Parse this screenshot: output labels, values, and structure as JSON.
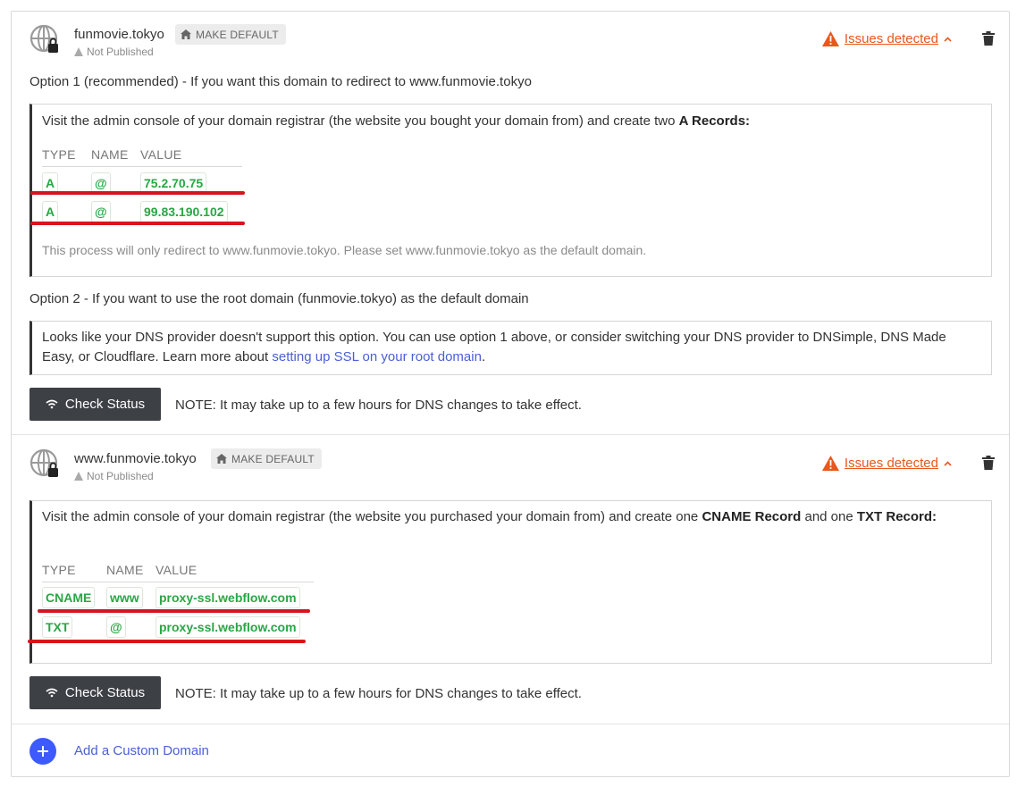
{
  "domains": [
    {
      "name": "funmovie.tokyo",
      "status": "Not Published",
      "make_default": "MAKE DEFAULT",
      "issues": "Issues detected",
      "option1_title": "Option 1 (recommended) - If you want this domain to redirect to www.funmovie.tokyo",
      "instructions_pre": "Visit the admin console of your domain registrar (the website you bought your domain from) and create two ",
      "instructions_bold": "A Records:",
      "headers": [
        "TYPE",
        "NAME",
        "VALUE"
      ],
      "records": [
        {
          "type": "A",
          "name": "@",
          "value": "75.2.70.75"
        },
        {
          "type": "A",
          "name": "@",
          "value": "99.83.190.102"
        }
      ],
      "redirect_note": "This process will only redirect to www.funmovie.tokyo. Please set www.funmovie.tokyo as the default domain.",
      "option2_title": "Option 2 - If you want to use the root domain (funmovie.tokyo) as the default domain",
      "option2_text": "Looks like your DNS provider doesn't support this option. You can use option 1 above, or consider switching your DNS provider to DNSimple, DNS Made Easy, or Cloudflare. Learn more about ",
      "option2_link": "setting up SSL on your root domain",
      "option2_end": ".",
      "check_status": "Check Status",
      "note": "NOTE: It may take up to a few hours for DNS changes to take effect."
    },
    {
      "name": "www.funmovie.tokyo",
      "status": "Not Published",
      "make_default": "MAKE DEFAULT",
      "issues": "Issues detected",
      "instructions_pre": "Visit the admin console of your domain registrar (the website you purchased your domain from) and create one ",
      "instructions_bold1": "CNAME Record",
      "instructions_mid": " and one ",
      "instructions_bold2": "TXT Record:",
      "headers": [
        "TYPE",
        "NAME",
        "VALUE"
      ],
      "records": [
        {
          "type": "CNAME",
          "name": "www",
          "value": "proxy-ssl.webflow.com"
        },
        {
          "type": "TXT",
          "name": "@",
          "value": "proxy-ssl.webflow.com"
        }
      ],
      "check_status": "Check Status",
      "note": "NOTE: It may take up to a few hours for DNS changes to take effect."
    }
  ],
  "add_domain": "Add a Custom Domain",
  "colors": {
    "accent_orange": "#e8581c",
    "record_green": "#28a745",
    "highlight_red": "#d8141e",
    "link_blue": "#4a5fd6",
    "button_dark": "#3d4045",
    "add_blue": "#3d5afe"
  }
}
